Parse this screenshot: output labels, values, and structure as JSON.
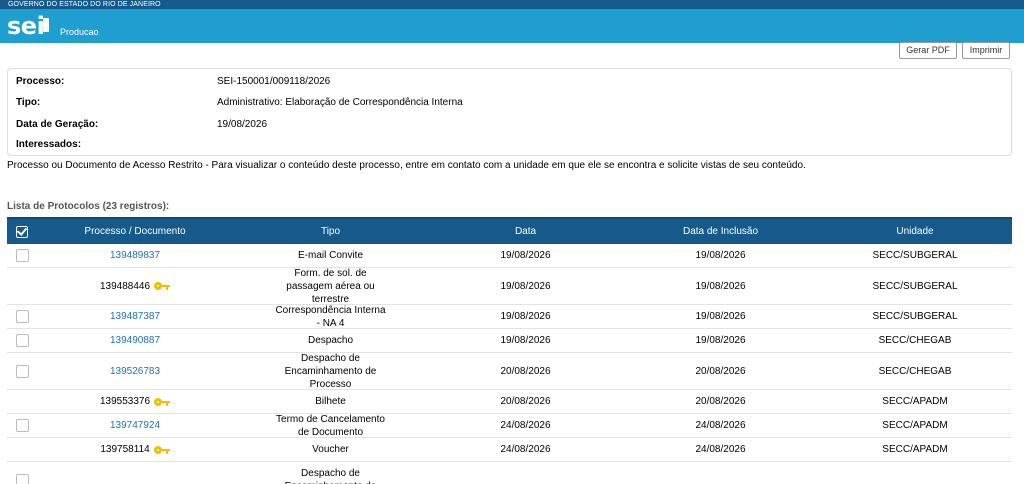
{
  "header": {
    "gov_label": "GOVERNO DO ESTADO DO RIO DE JANEIRO",
    "logo_text": "sei",
    "environment": "Producao"
  },
  "toolbar": {
    "pdf_label": "Gerar PDF",
    "print_label": "Imprimir"
  },
  "process": {
    "fields": [
      {
        "label": "Processo:",
        "value": "SEI-150001/009118/2026"
      },
      {
        "label": "Tipo:",
        "value": "Administrativo: Elaboração de Correspondência Interna"
      },
      {
        "label": "Data de Geração:",
        "value": "19/08/2026"
      },
      {
        "label": "Interessados:",
        "value": ""
      }
    ],
    "notice": "Processo ou Documento de Acesso Restrito - Para visualizar o conteúdo deste processo, entre em contato com a unidade em que ele se encontra e solicite vistas de seu conteúdo."
  },
  "protocols": {
    "caption": "Lista de Protocolos (23 registros):",
    "columns": [
      "Processo / Documento",
      "Tipo",
      "Data",
      "Data de Inclusão",
      "Unidade"
    ],
    "rows": [
      {
        "doc": "139489837",
        "tipo": "E-mail Convite",
        "data": "19/08/2026",
        "inclusao": "19/08/2026",
        "unidade": "SECC/SUBGERAL",
        "restricted": false
      },
      {
        "doc": "139488446",
        "tipo": "Form. de sol. de passagem aérea ou terrestre",
        "data": "19/08/2026",
        "inclusao": "19/08/2026",
        "unidade": "SECC/SUBGERAL",
        "restricted": true
      },
      {
        "doc": "139487387",
        "tipo": "Correspondência Interna - NA 4",
        "data": "19/08/2026",
        "inclusao": "19/08/2026",
        "unidade": "SECC/SUBGERAL",
        "restricted": false
      },
      {
        "doc": "139490887",
        "tipo": "Despacho",
        "data": "19/08/2026",
        "inclusao": "19/08/2026",
        "unidade": "SECC/CHEGAB",
        "restricted": false
      },
      {
        "doc": "139526783",
        "tipo": "Despacho de Encaminhamento de Processo",
        "data": "20/08/2026",
        "inclusao": "20/08/2026",
        "unidade": "SECC/CHEGAB",
        "restricted": false
      },
      {
        "doc": "139553376",
        "tipo": "Bilhete",
        "data": "20/08/2026",
        "inclusao": "20/08/2026",
        "unidade": "SECC/APADM",
        "restricted": true
      },
      {
        "doc": "139747924",
        "tipo": "Termo de Cancelamento de Documento",
        "data": "24/08/2026",
        "inclusao": "24/08/2026",
        "unidade": "SECC/APADM",
        "restricted": false
      },
      {
        "doc": "139758114",
        "tipo": "Voucher",
        "data": "24/08/2026",
        "inclusao": "24/08/2026",
        "unidade": "SECC/APADM",
        "restricted": true
      },
      {
        "doc": "",
        "tipo": "Despacho de Encaminhamento de",
        "data": "",
        "inclusao": "",
        "unidade": "",
        "restricted": false
      }
    ]
  }
}
